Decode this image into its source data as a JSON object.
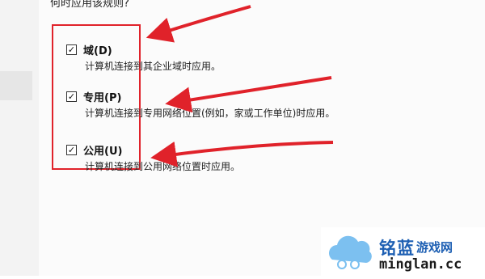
{
  "dialog": {
    "question": "何时应用该规则?",
    "options": [
      {
        "checked": true,
        "title": "域(D)",
        "description": "计算机连接到其企业域时应用。"
      },
      {
        "checked": true,
        "title": "专用(P)",
        "description": "计算机连接到专用网络位置(例如，家或工作单位)时应用。"
      },
      {
        "checked": true,
        "title": "公用(U)",
        "description": "计算机连接到公用网络位置时应用。"
      }
    ]
  },
  "icons": {
    "checkbox": "check-icon",
    "annotation": "red-arrow-icon"
  },
  "colors": {
    "annotation": "#e0222a",
    "logo": "#1d5fb3"
  },
  "watermark": {
    "brand": "铭蓝",
    "tagline": "游戏网",
    "url": "minglan.cc"
  }
}
